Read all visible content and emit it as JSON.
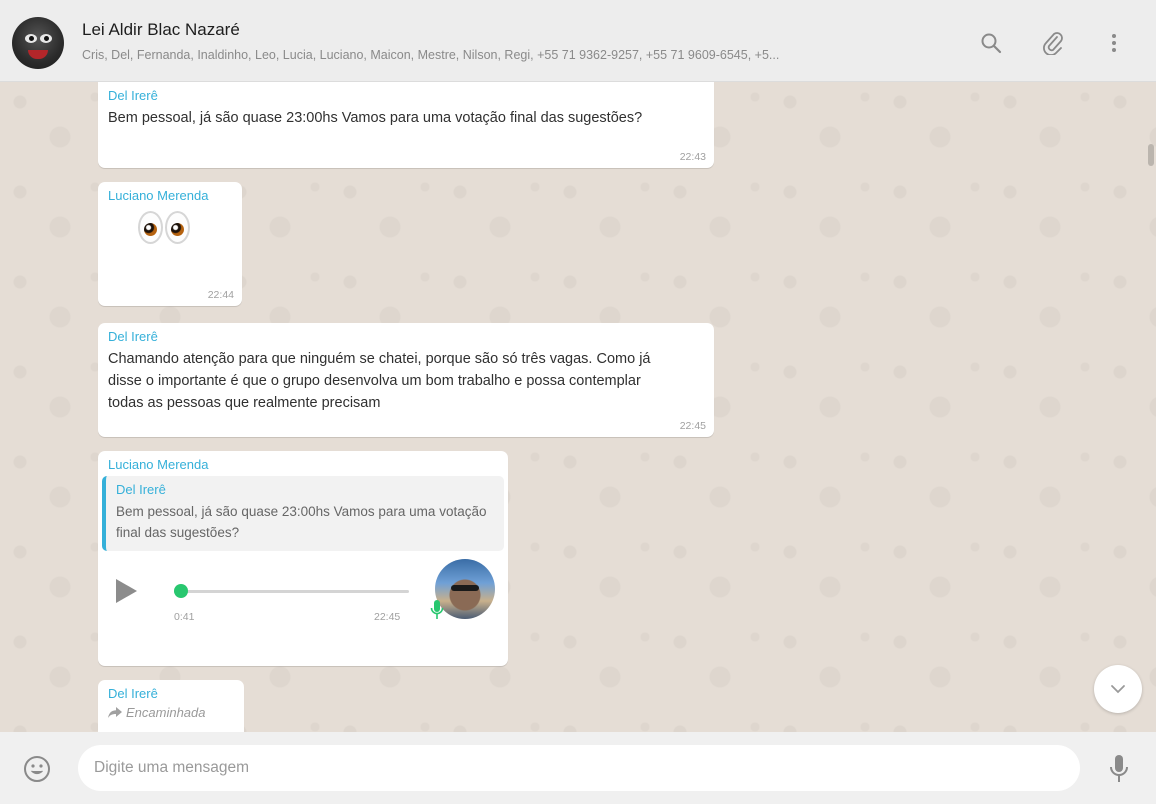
{
  "header": {
    "title": "Lei Aldir Blac Nazaré",
    "subtitle": "Cris, Del, Fernanda, Inaldinho, Leo, Lucia, Luciano, Maicon, Mestre, Nilson, Regi, +55 71 9362-9257, +55 71 9609-6545, +5...",
    "icons": [
      "search-icon",
      "attach-icon",
      "menu-icon"
    ]
  },
  "messages": [
    {
      "sender": "Del Irerê",
      "text": "Bem pessoal, já são quase 23:00hs Vamos para uma votação final das sugestões?",
      "time": "22:43"
    },
    {
      "sender": "Luciano Merenda",
      "emoji": "eyes",
      "time": "22:44"
    },
    {
      "sender": "Del Irerê",
      "text": "Chamando atenção para que ninguém se chatei, porque são só três vagas. Como já disse o importante é que o grupo desenvolva um bom trabalho e possa contemplar todas as pessoas que realmente precisam",
      "time": "22:45"
    },
    {
      "sender": "Luciano Merenda",
      "quote": {
        "sender": "Del Irerê",
        "text": "Bem pessoal, já são quase 23:00hs Vamos para uma votação final das sugestões?"
      },
      "audio": {
        "duration": "0:41",
        "progress": 0.0
      },
      "time": "22:45"
    },
    {
      "sender": "Del Irerê",
      "forwarded_label": "Encaminhada"
    }
  ],
  "composer": {
    "placeholder": "Digite uma mensagem",
    "icons": [
      "emoji-icon",
      "microphone-icon"
    ]
  },
  "colors": {
    "sender": "#35b0d9",
    "chat_bg": "#e5ddd5",
    "audio_knob": "#28c76f"
  }
}
